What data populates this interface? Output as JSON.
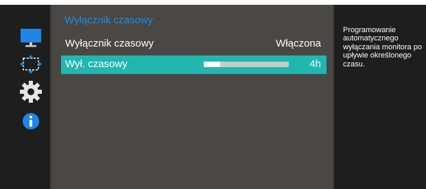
{
  "menu": {
    "title": "Wyłącznik czasowy",
    "items": [
      {
        "label": "Wyłącznik czasowy",
        "value": "Włączona"
      },
      {
        "label": "Wył. czasowy",
        "value": "4h",
        "progress": 0.19
      }
    ]
  },
  "help": {
    "text": "Programowanie automatycznego wyłączania monitora po upływie określonego czasu."
  },
  "sidebar": {
    "icons": [
      "monitor-icon",
      "size-position-icon",
      "gear-icon",
      "info-icon"
    ]
  },
  "colors": {
    "accent": "#1e8fe6",
    "selection": "#22b6b0",
    "panel_bg": "#4a4744",
    "frame_bg": "#1e1e1e"
  }
}
